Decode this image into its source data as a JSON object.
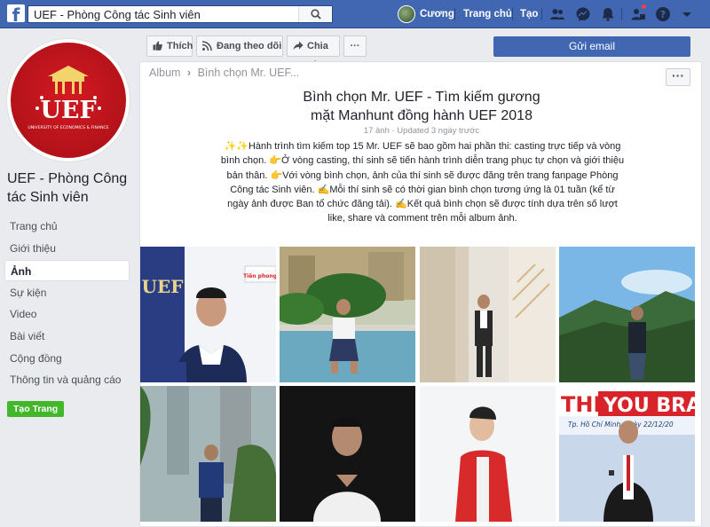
{
  "topbar": {
    "search_value": "UEF - Phòng Công tác Sinh viên",
    "user_name": "Cương",
    "home_label": "Trang chủ",
    "create_label": "Tạo"
  },
  "left_nav": {
    "page_name": "UEF - Phòng Công tác Sinh viên",
    "logo_text": "UEF",
    "logo_subtext": "UNIVERSITY OF ECONOMICS & FINANCE",
    "items": [
      "Trang chủ",
      "Giới thiệu",
      "Ảnh",
      "Sự kiện",
      "Video",
      "Bài viết",
      "Cộng đồng",
      "Thông tin và quảng cáo"
    ],
    "active_item": "Ảnh",
    "create_page_label": "Tạo Trang"
  },
  "actions": {
    "like_label": "Thích",
    "follow_label": "Đang theo dõi",
    "share_label": "Chia sẻ",
    "more_label": "···",
    "email_label": "Gửi email"
  },
  "album": {
    "breadcrumb_root": "Album",
    "breadcrumb_current": "Bình chọn Mr. UEF...",
    "title_line1": "Bình chọn Mr. UEF - Tìm kiếm gương",
    "title_line2": "mặt Manhunt đồng hành UEF 2018",
    "meta": "17 ảnh · Updated 3 ngày trước",
    "description": "✨✨Hành trình tìm kiếm top 15 Mr. UEF sẽ bao gồm hai phần thi: casting trực tiếp và vòng bình chọn. 👉Ở vòng casting, thí sinh sẽ tiến hành trình diễn trang phục tự chọn và giới thiệu bản thân. 👉Với vòng bình chọn, ảnh của thí sinh sẽ được đăng trên trang fanpage Phòng Công tác Sinh viên. ✍Mỗi thí sinh sẽ có thời gian bình chọn tương ứng là 01 tuần (kể từ ngày ảnh được Ban tổ chức đăng tải). ✍Kết quả bình chọn sẽ được tính dựa trên số lượt like, share và comment trên mỗi album ảnh.",
    "photo1_signage": "UEF",
    "photo1_brand": "Tiền phong",
    "photo8_banner_a": "THI",
    "photo8_banner_b": "YOU BRA",
    "photo8_banner_c": "Tp. Hồ Chí Minh, ngày 22/12/20"
  },
  "colors": {
    "facebook_blue": "#4267b2",
    "green_button": "#42b72a",
    "uef_red": "#c8161d"
  }
}
